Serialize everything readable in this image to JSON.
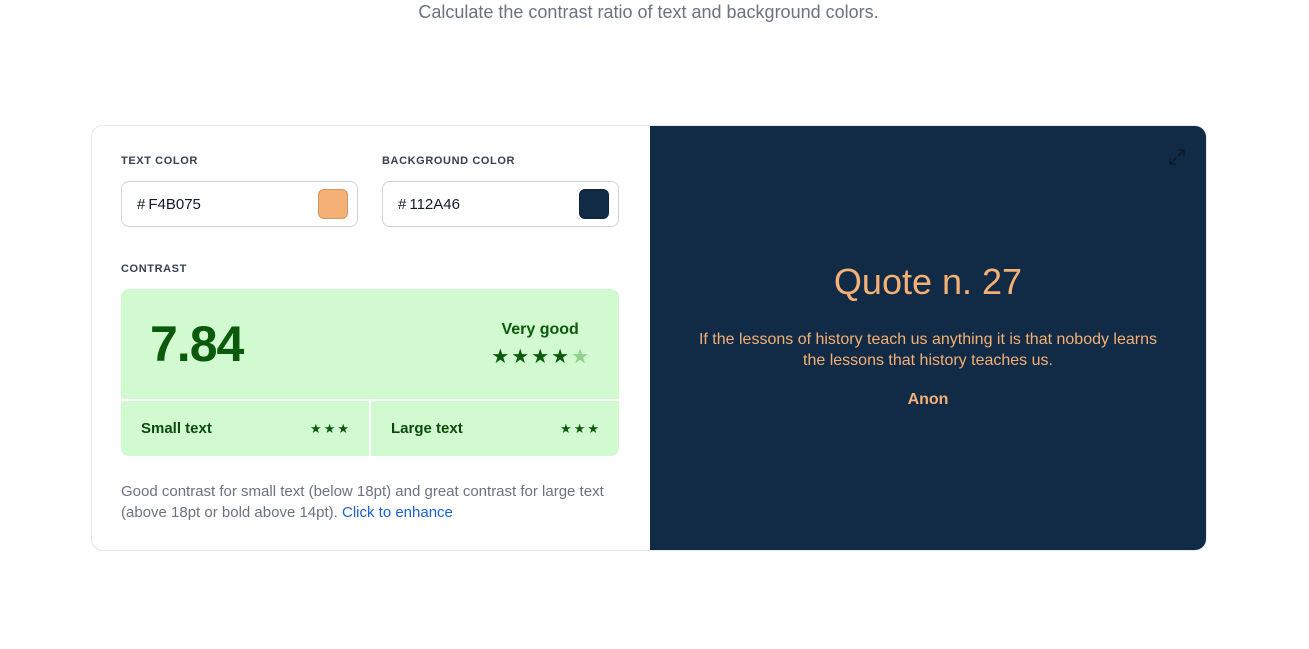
{
  "page": {
    "subtitle": "Calculate the contrast ratio of text and background colors."
  },
  "text_color": {
    "label": "TEXT COLOR",
    "hash": "#",
    "value": "F4B075",
    "swatch": "#F4B075"
  },
  "background_color": {
    "label": "BACKGROUND COLOR",
    "hash": "#",
    "value": "112A46",
    "swatch": "#112A46"
  },
  "contrast": {
    "label": "CONTRAST",
    "ratio": "7.84",
    "rating": "Very good",
    "stars_filled": 4,
    "stars_total": 5,
    "small_text": {
      "label": "Small text",
      "stars": 3
    },
    "large_text": {
      "label": "Large text",
      "stars": 3
    },
    "description": "Good contrast for small text (below 18pt) and great contrast for large text (above 18pt or bold above 14pt).",
    "enhance_link": "Click to enhance",
    "box_color": "#D2FAD0",
    "accent_color": "#0B5A0B"
  },
  "preview": {
    "title": "Quote n. 27",
    "text": "If the lessons of history teach us anything it is that nobody learns the lessons that history teaches us.",
    "author": "Anon",
    "expand_icon": "expand-icon"
  }
}
